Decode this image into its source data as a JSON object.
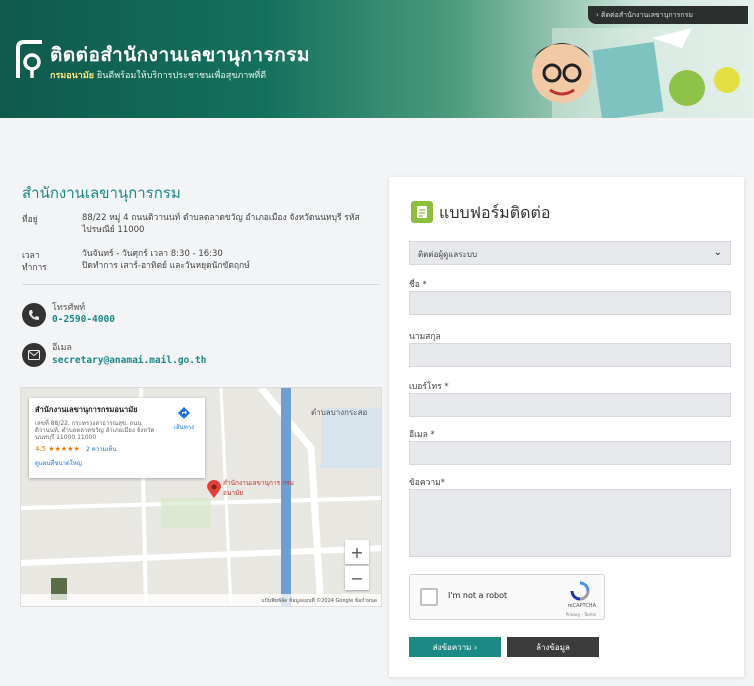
{
  "banner": {
    "title": "ติดต่อสำนักงานเลขานุการกรม",
    "sub_brand": "กรมอนามัย",
    "sub_text": "ยินดีพร้อมให้บริการประชาชนเพื่อสุขภาพที่ดี",
    "breadcrumb": "› ติดต่อสำนักงานเลขานุการกรม",
    "colors": {
      "primary": "#13705c",
      "accent": "#1b8a86"
    }
  },
  "org": {
    "title": "สำนักงานเลขานุการกรม",
    "address_label": "ที่อยู่",
    "address_line1": "88/22 หมู่ 4 ถนนติวานนท์ ตำบลตลาดขวัญ อำเภอเมือง จังหวัดนนทบุรี รหัส",
    "address_line2": "ไปรษณีย์ 11000",
    "hours_label_1": "เวลา",
    "hours_label_2": "ทำการ",
    "hours_line1": "วันจันทร์ - วันศุกร์ เวลา 8:30 - 16:30",
    "hours_line2": "ปิดทำการ เสาร์-อาทิตย์ และวันหยุดนักขัตฤกษ์"
  },
  "contacts": {
    "phone_label": "โทรศัพท์",
    "phone_value": "0-2590-4000",
    "email_label": "อีเมล",
    "email_value": "secretary@anamai.mail.go.th",
    "phone_icon": "phone-icon",
    "email_icon": "mail-icon"
  },
  "map": {
    "card_title": "สำนักงานเลขานุการกรมอนามัย",
    "card_address": "เลขที่ 88/22, กระทรวงสาธารณสุข, ถนน ติวานนท์, ตำบลตลาดขวัญ อำเภอเมือง จังหวัดนนทบุรี 11000 11000",
    "rating": "4.5",
    "stars": "★★★★★",
    "reviews": "2 ความเห็น",
    "larger_map": "ดูแผนที่ขนาดใหญ่",
    "directions": "เส้นทาง",
    "pin_label": "สำนักงานเลขานุการ กรมอนามัย",
    "area_label": "ตำบลบางกระสอ",
    "footer": "แป้นพิมพ์ลัด  ข้อมูลแผนที่ ©2024 Google  ข้อกำหนด",
    "zoom_in": "+",
    "zoom_out": "−"
  },
  "form": {
    "title": "แบบฟอร์มติดต่อ",
    "select_value": "ติดต่อผู้ดูแลระบบ",
    "name_label": "ชื่อ *",
    "surname_label": "นามสกุล",
    "phone_label": "เบอร์โทร *",
    "email_label": "อีเมล *",
    "message_label": "ข้อความ*",
    "recaptcha_text": "I'm not a robot",
    "recaptcha_brand": "reCAPTCHA",
    "recaptcha_terms": "Privacy - Terms",
    "submit_label": "ส่งข้อความ  ›",
    "reset_label": "ล้างข้อมูล"
  }
}
